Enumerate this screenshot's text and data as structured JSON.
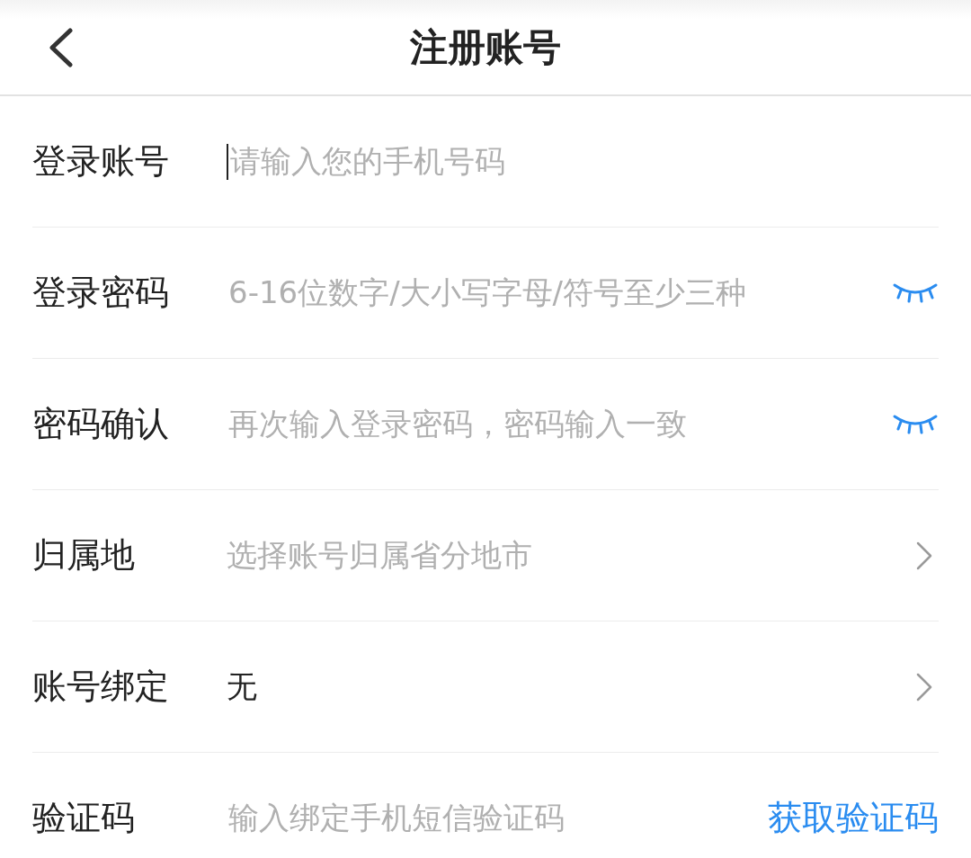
{
  "header": {
    "title": "注册账号"
  },
  "fields": [
    {
      "kind": "input",
      "label": "登录账号",
      "placeholder": "请输入您的手机号码",
      "focused": true
    },
    {
      "kind": "password",
      "label": "登录密码",
      "placeholder": "6-16位数字/大小写字母/符号至少三种"
    },
    {
      "kind": "password",
      "label": "密码确认",
      "placeholder": "再次输入登录密码，密码输入一致"
    },
    {
      "kind": "select",
      "label": "归属地",
      "placeholder": "选择账号归属省分地市"
    },
    {
      "kind": "value",
      "label": "账号绑定",
      "value": "无"
    },
    {
      "kind": "code",
      "label": "验证码",
      "placeholder": "输入绑定手机短信验证码",
      "action": "获取验证码"
    }
  ]
}
